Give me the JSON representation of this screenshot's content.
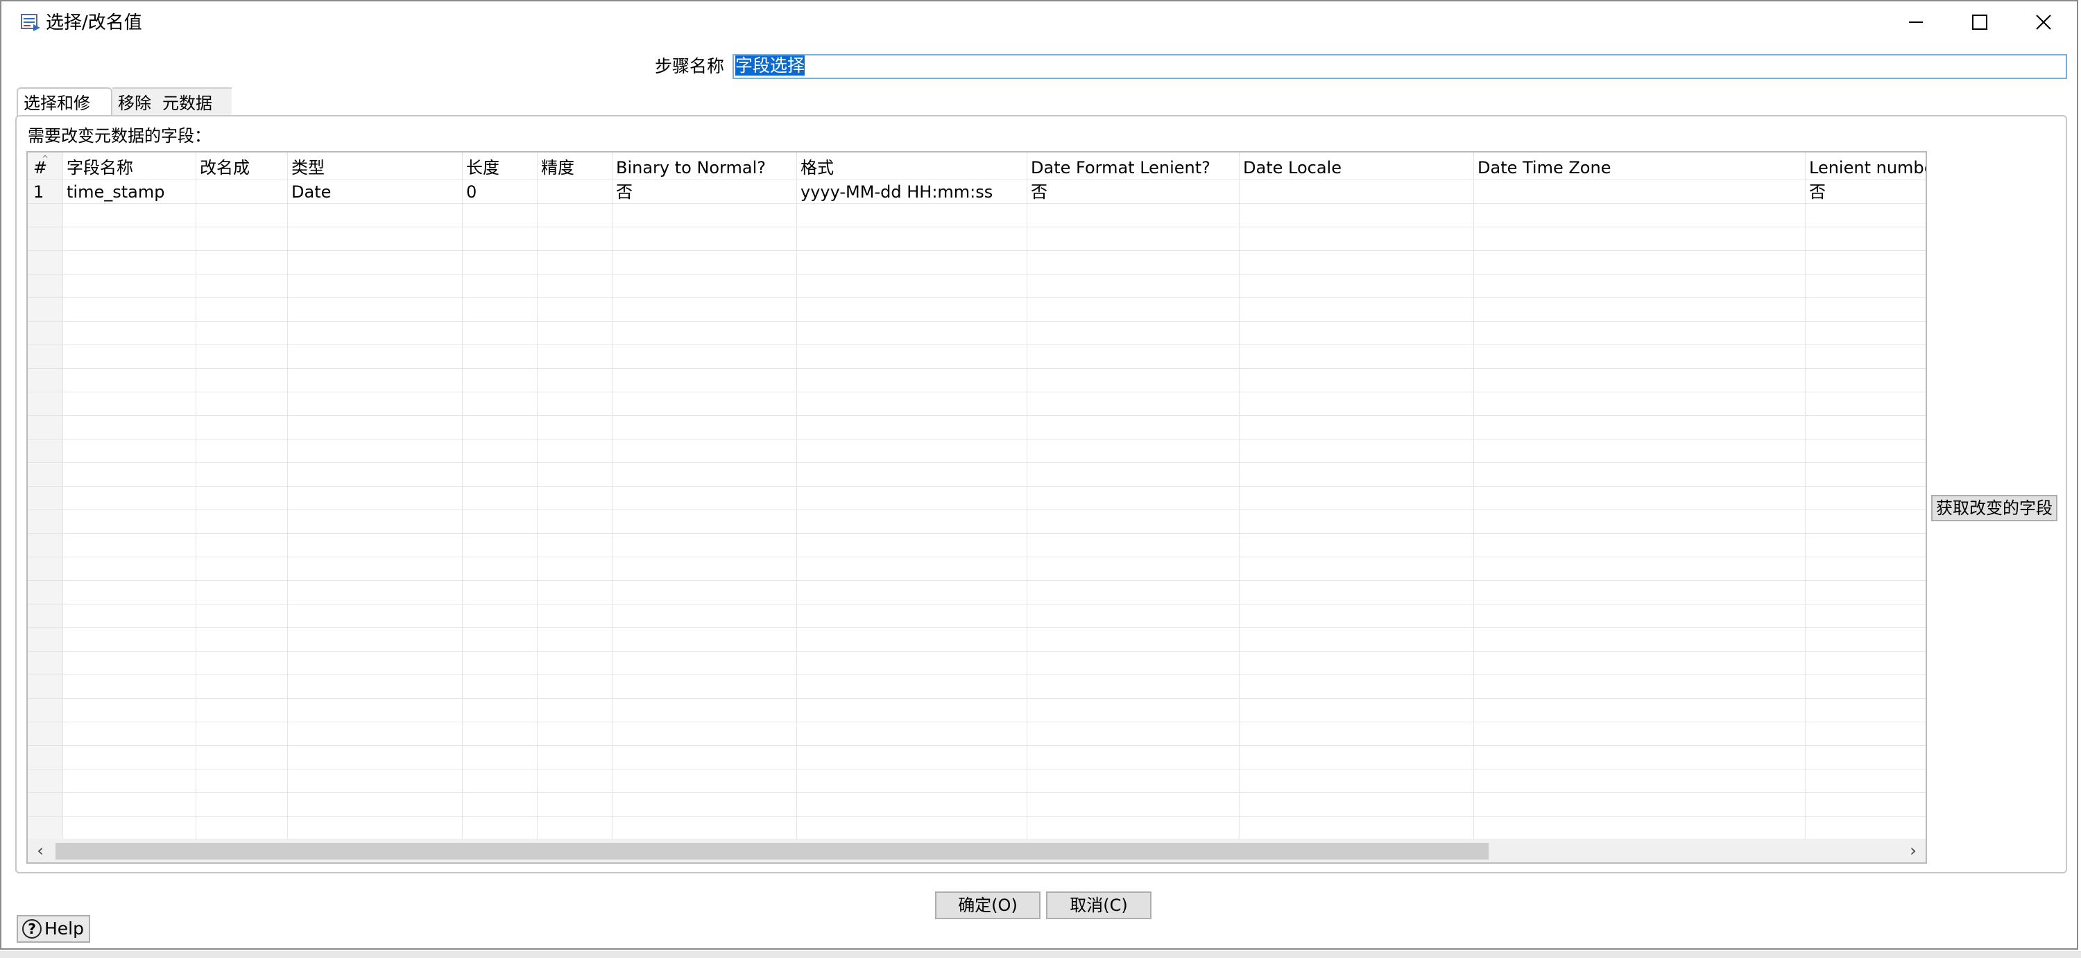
{
  "window": {
    "title": "选择/改名值",
    "controls": [
      "minimize",
      "maximize",
      "close"
    ]
  },
  "step": {
    "label": "步骤名称",
    "value": "字段选择"
  },
  "tabs": [
    {
      "label": "选择和修改",
      "active": false
    },
    {
      "label": "移除",
      "active": false
    },
    {
      "label": "元数据",
      "active": true
    }
  ],
  "metadata": {
    "section_label": "需要改变元数据的字段：",
    "columns": [
      "#",
      "字段名称",
      "改名成",
      "类型",
      "长度",
      "精度",
      "Binary to Normal?",
      "格式",
      "Date Format Lenient?",
      "Date Locale",
      "Date Time Zone",
      "Lenient numbe"
    ],
    "rows": [
      [
        "1",
        "time_stamp",
        "",
        "Date",
        "0",
        "",
        "否",
        "yyyy-MM-dd HH:mm:ss",
        "否",
        "",
        "",
        "否"
      ]
    ],
    "get_fields_button": "获取改变的字段"
  },
  "buttons": {
    "ok": "确定(O)",
    "cancel": "取消(C)",
    "help": "Help"
  },
  "icons": {
    "app": "select-values-icon",
    "help": "help-circle-icon"
  },
  "colors": {
    "selection": "#0a6ad1",
    "input_border": "#7ab0d8",
    "button_bg": "#e1e1e1"
  }
}
